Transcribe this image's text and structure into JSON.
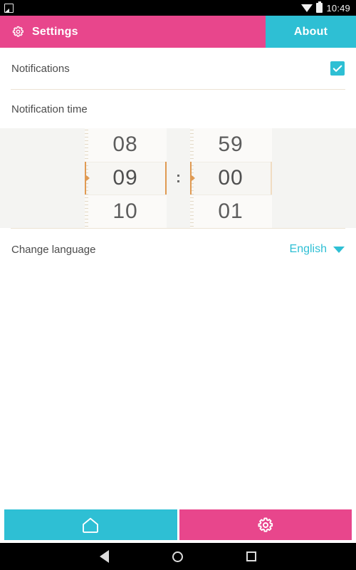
{
  "statusbar": {
    "notification_icon": "screenshot-icon",
    "wifi_icon": "wifi-icon",
    "battery_icon": "battery-icon",
    "time": "10:49"
  },
  "tabs": [
    {
      "label": "Settings",
      "icon": "gear-icon",
      "active": true,
      "color": "#e8468c"
    },
    {
      "label": "About",
      "icon": "",
      "active": false,
      "color": "#2ebfd4"
    }
  ],
  "settings": {
    "notifications": {
      "label": "Notifications",
      "checked": true,
      "checkbox_color": "#2ebfd4"
    },
    "notification_time": {
      "label": "Notification time",
      "separator": ":",
      "hour": {
        "previous": "08",
        "selected": "09",
        "next": "10"
      },
      "minute": {
        "previous": "59",
        "selected": "00",
        "next": "01"
      },
      "selection_accent": "#e09a52"
    },
    "change_language": {
      "label": "Change language",
      "value": "English",
      "caret_icon": "chevron-down-icon",
      "value_color": "#2ebfd4"
    }
  },
  "bottombar": {
    "home": {
      "icon": "home-icon",
      "color": "#2ebfd4"
    },
    "settings": {
      "icon": "gear-icon",
      "color": "#e8468c"
    }
  },
  "navbar": {
    "back": "back-triangle-icon",
    "home": "home-circle-icon",
    "recents": "recents-square-icon"
  }
}
